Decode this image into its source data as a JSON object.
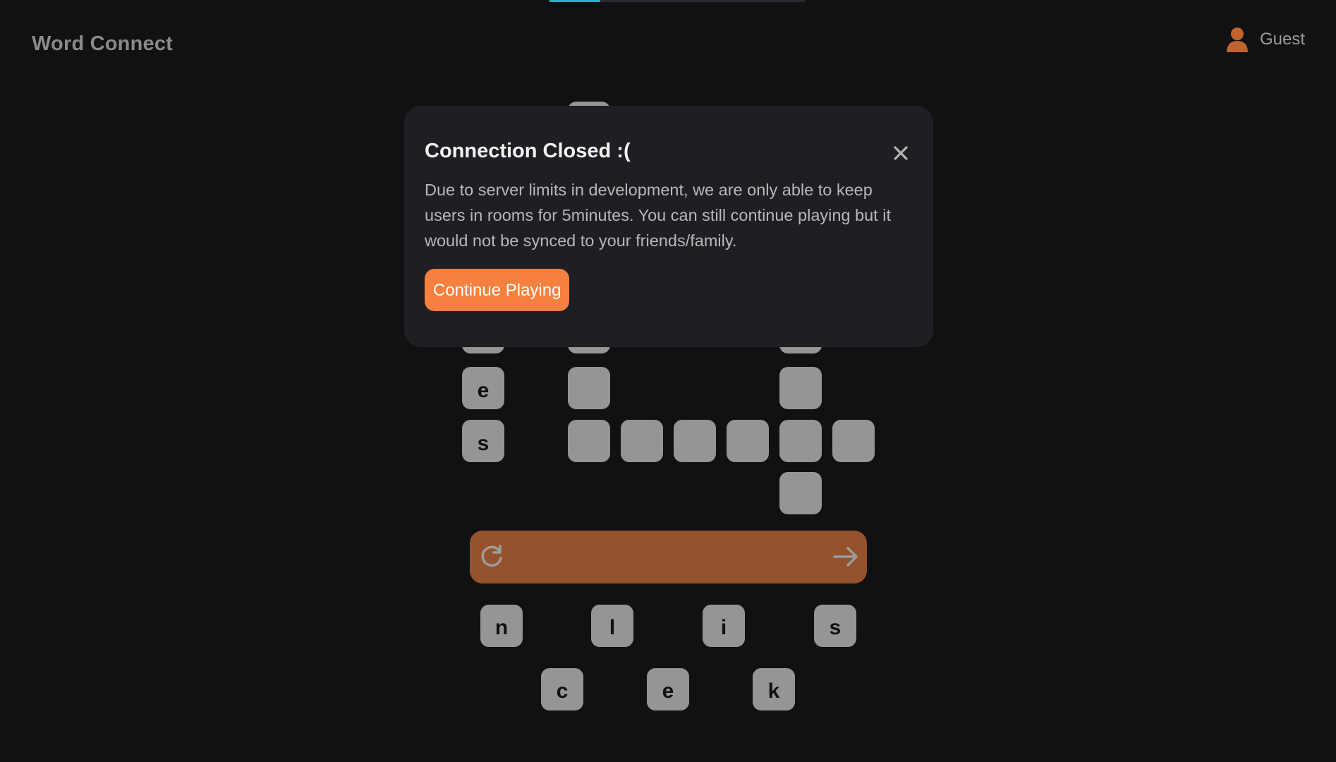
{
  "header": {
    "app_title": "Word Connect",
    "user_label": "Guest",
    "user_icon": "person-icon"
  },
  "board": {
    "revealed_letters": {
      "e": "e",
      "s": "s"
    }
  },
  "input_bar": {
    "shuffle_icon": "refresh-icon",
    "submit_icon": "arrow-right-icon"
  },
  "letter_wheel": {
    "letters": [
      "n",
      "l",
      "i",
      "s",
      "c",
      "e",
      "k"
    ]
  },
  "modal": {
    "title": "Connection Closed :(",
    "message": "Due to server limits in development, we are only able to keep users in rooms for 5minutes. You can still continue playing but it would not be synced to your friends/family.",
    "button_label": "Continue Playing",
    "close_icon": "close-icon"
  },
  "colors": {
    "background": "#111113",
    "accent": "#f5803f",
    "input_bar": "#96522c",
    "tile": "#959595",
    "modal_bg": "#1f1e22",
    "progress": "#1fb5c4",
    "user_icon": "#c0642e"
  }
}
